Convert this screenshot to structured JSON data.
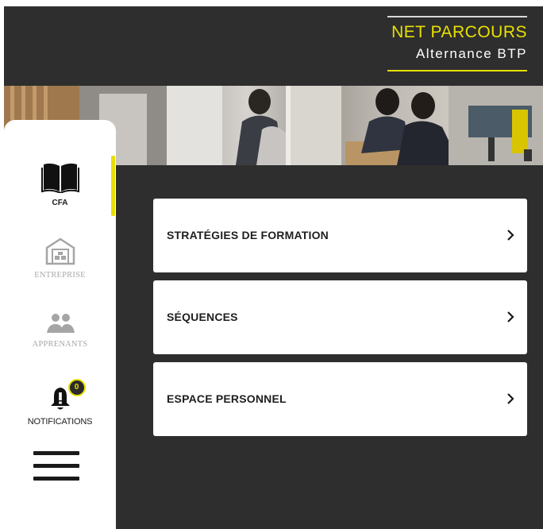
{
  "brand": {
    "title": "NET PARCOURS",
    "subtitle": "Alternance BTP",
    "accent_color": "#e8e000"
  },
  "sidebar": {
    "items": [
      {
        "label": "CFA",
        "icon": "open-book-icon",
        "state": "active"
      },
      {
        "label": "ENTREPRISE",
        "icon": "warehouse-icon",
        "state": "inactive"
      },
      {
        "label": "APPRENANTS",
        "icon": "users-icon",
        "state": "inactive"
      },
      {
        "label": "NOTIFICATIONS",
        "icon": "bell-icon",
        "badge": "0",
        "state": "normal"
      }
    ],
    "menu_icon": "hamburger-menu-icon"
  },
  "menu": {
    "items": [
      {
        "label": "STRATÉGIES DE FORMATION",
        "icon": "chevron-right-icon"
      },
      {
        "label": "SÉQUENCES",
        "icon": "chevron-right-icon"
      },
      {
        "label": "ESPACE PERSONNEL",
        "icon": "chevron-right-icon"
      }
    ]
  }
}
